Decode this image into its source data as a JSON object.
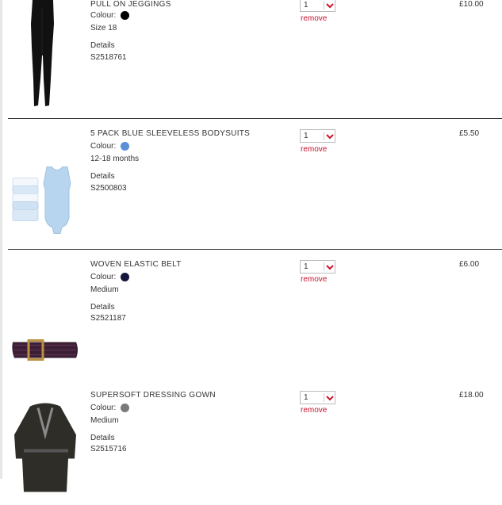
{
  "labels": {
    "colour": "Colour:",
    "details": "Details",
    "remove": "remove"
  },
  "items": [
    {
      "title": "PULL ON JEGGINGS",
      "swatch_color": "#000000",
      "size": "Size 18",
      "code": "S2518761",
      "qty": "1",
      "price": "£10.00",
      "image": "black-jeggings"
    },
    {
      "title": "5 PACK BLUE SLEEVELESS BODYSUITS",
      "swatch_color": "#5b8fd6",
      "size": "12-18 months",
      "code": "S2500803",
      "qty": "1",
      "price": "£5.50",
      "image": "blue-bodysuits"
    },
    {
      "title": "WOVEN ELASTIC BELT",
      "swatch_color": "#14163d",
      "size": "Medium",
      "code": "S2521187",
      "qty": "1",
      "price": "£6.00",
      "image": "woven-belt"
    },
    {
      "title": "SUPERSOFT DRESSING GOWN",
      "swatch_color": "#7a7a7a",
      "size": "Medium",
      "code": "S2515716",
      "qty": "1",
      "price": "£18.00",
      "image": "dressing-gown"
    }
  ],
  "colors": {
    "remove": "#c5162e",
    "accent_red": "#d0112b"
  }
}
